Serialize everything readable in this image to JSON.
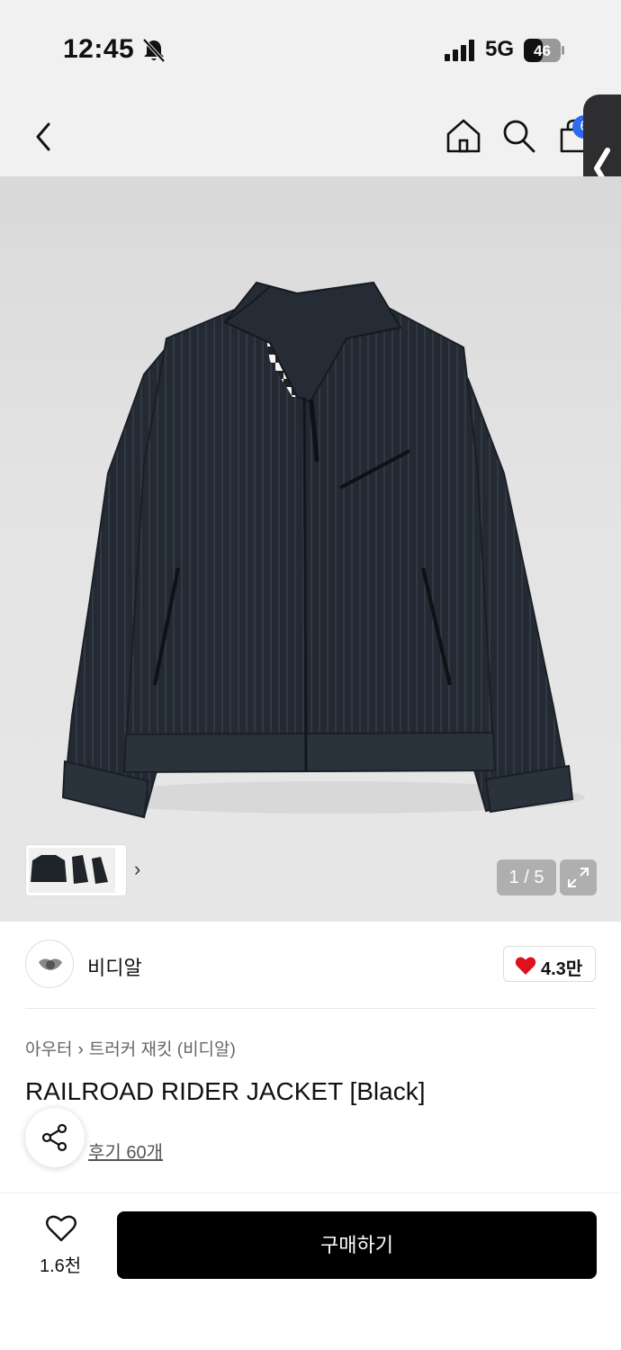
{
  "status_bar": {
    "time": "12:45",
    "network": "5G",
    "battery": "46"
  },
  "nav": {
    "cart_badge": "6"
  },
  "gallery": {
    "pager": "1 / 5"
  },
  "brand": {
    "name": "비디알",
    "likes": "4.3만"
  },
  "breadcrumb": {
    "category": "아우터",
    "subcategory": "트러커 재킷 (비디알)"
  },
  "product": {
    "title": "RAILROAD RIDER JACKET [Black]",
    "reviews_link": "후기 60개"
  },
  "bottom": {
    "wish_count": "1.6천",
    "buy_label": "구매하기"
  },
  "colors": {
    "accent_blue": "#2d6cf2",
    "heart_red": "#e0101d",
    "buy_button": "#000000"
  }
}
